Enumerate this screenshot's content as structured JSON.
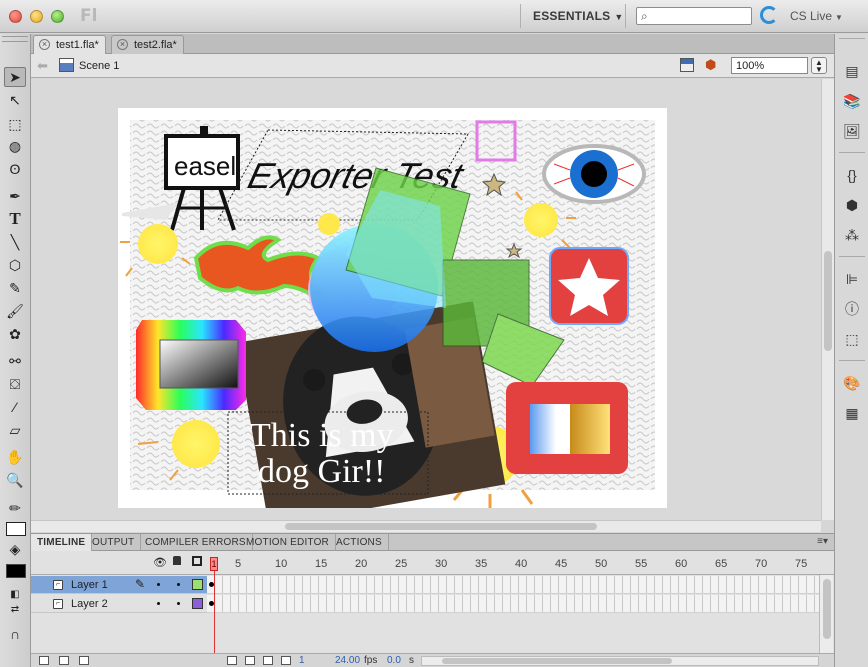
{
  "app": {
    "logo": "Fl"
  },
  "titlebar": {
    "workspace_label": "ESSENTIALS",
    "search_placeholder": "",
    "cs_live_label": "CS Live"
  },
  "document_tabs": [
    {
      "label": "test1.fla*",
      "active": true
    },
    {
      "label": "test2.fla*",
      "active": false
    }
  ],
  "editbar": {
    "scene_label": "Scene 1",
    "zoom_value": "100%"
  },
  "stage": {
    "title_text": "Exporter Test",
    "easel_text": "easel",
    "caption_line1": "This is my",
    "caption_line2": "dog Gir!!"
  },
  "panel_tabs": [
    "TIMELINE",
    "OUTPUT",
    "COMPILER ERRORS",
    "MOTION EDITOR",
    "ACTIONS"
  ],
  "timeline": {
    "frame_numbers": [
      "5",
      "10",
      "15",
      "20",
      "25",
      "30",
      "35",
      "40",
      "45",
      "50",
      "55",
      "60",
      "65",
      "70",
      "75"
    ],
    "playhead_label": "1",
    "layers": [
      {
        "name": "Layer 1",
        "selected": true,
        "color": "#9be070"
      },
      {
        "name": "Layer 2",
        "selected": false,
        "color": "#8a5fd8"
      }
    ],
    "current_frame": "1",
    "fps_value": "24.00",
    "fps_unit": "fps",
    "time_value": "0.0",
    "time_unit": "s"
  }
}
